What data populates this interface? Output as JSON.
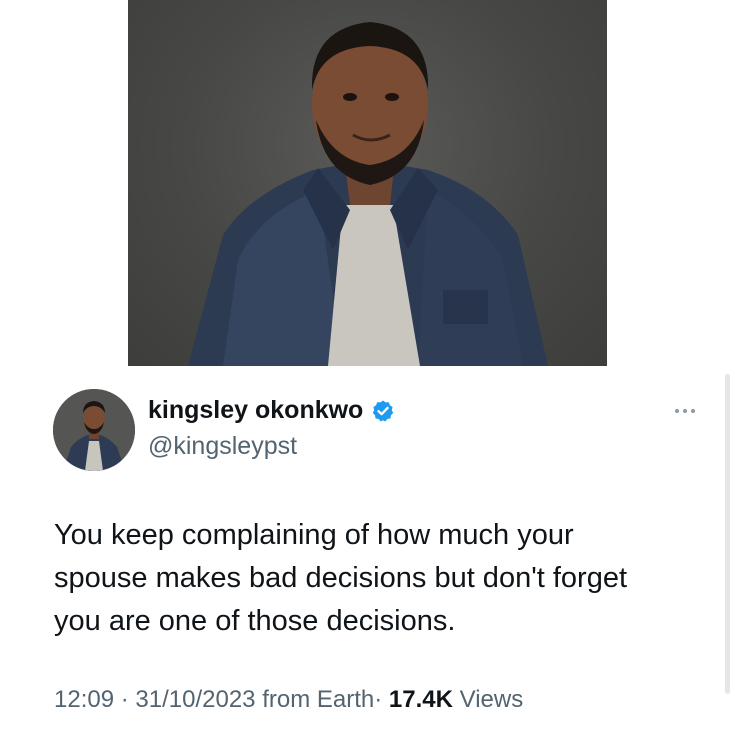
{
  "tweet": {
    "author": {
      "display_name": "kingsley okonkwo",
      "handle": "@kingsleypst",
      "verified_icon": "verified-badge-icon",
      "verified_color": "#1d9bf0"
    },
    "text_lines": [
      "You keep complaining of how much your",
      "spouse makes bad decisions but don't forget",
      "you are one of those decisions."
    ],
    "meta": {
      "time": "12:09",
      "separator": "·",
      "date": "31/10/2023",
      "source": "from Earth",
      "views_count": "17.4K",
      "views_label": "Views"
    },
    "more_icon": "more-options-icon"
  },
  "colors": {
    "text_primary": "#0f1419",
    "text_secondary": "#536471",
    "accent": "#1d9bf0"
  }
}
